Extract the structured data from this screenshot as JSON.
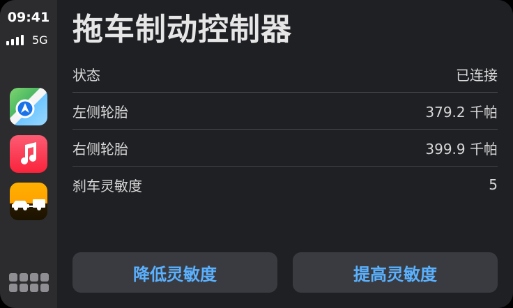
{
  "status_bar": {
    "time": "09:41",
    "network": "5G"
  },
  "sidebar": {
    "apps": [
      {
        "name": "maps-app-icon"
      },
      {
        "name": "music-app-icon"
      },
      {
        "name": "tow-app-icon"
      }
    ]
  },
  "main": {
    "title": "拖车制动控制器",
    "rows": [
      {
        "label": "状态",
        "value": "已连接"
      },
      {
        "label": "左侧轮胎",
        "value": "379.2 千帕"
      },
      {
        "label": "右侧轮胎",
        "value": "399.9 千帕"
      },
      {
        "label": "刹车灵敏度",
        "value": "5"
      }
    ],
    "buttons": {
      "decrease": "降低灵敏度",
      "increase": "提高灵敏度"
    }
  },
  "colors": {
    "accent": "#5ab1ff"
  }
}
